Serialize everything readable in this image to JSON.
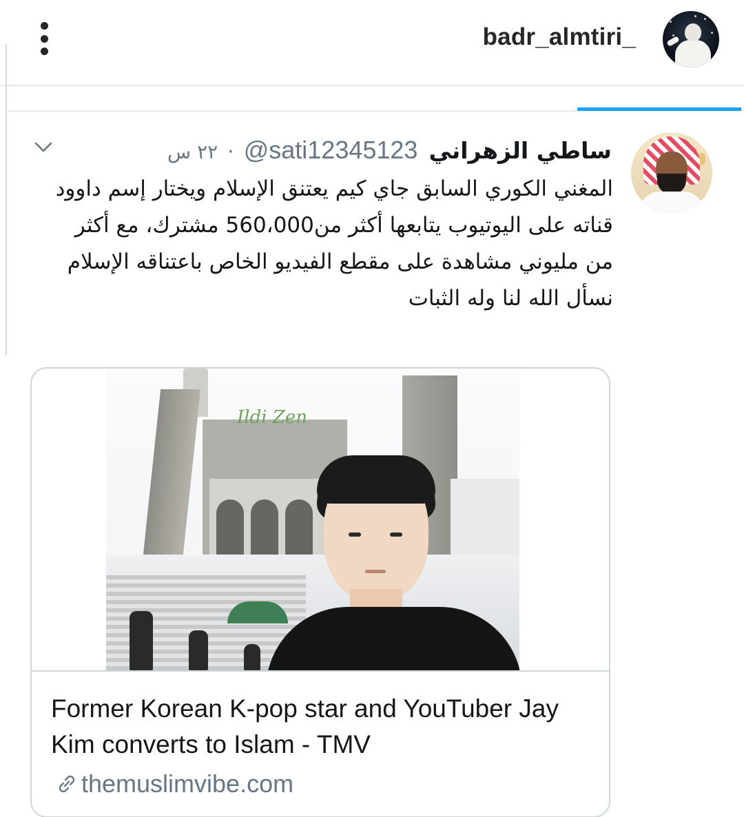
{
  "instagram": {
    "username": "badr_almtiri_",
    "more_icon": "more-vertical-icon"
  },
  "tweet": {
    "display_name": "ساطي الزهراني",
    "handle": "@sati12345123",
    "separator": "·",
    "time": "٢٢ س",
    "body_lines": [
      "المغني الكوري السابق جاي كيم يعتنق الإسلام  ويختار إسم داوود",
      "قناته على اليوتيوب يتابعها أكثر من560،000  مشترك، مع أكثر من مليوني مشاهدة على مقطع الفيديو الخاص باعتناقه الإسلام نسأل الله لنا وله الثبات"
    ],
    "menu_icon": "chevron-down-icon",
    "link_card": {
      "image_alt": "Young man taking a selfie in front of a mosque",
      "title": "Former Korean K-pop star and YouTuber Jay Kim converts to Islam - TMV",
      "domain": "themuslimvibe.com",
      "domain_icon": "link-icon"
    }
  },
  "colors": {
    "twitter_blue": "#1da1f2",
    "secondary_text": "#657786",
    "border": "#ccd6dd"
  }
}
